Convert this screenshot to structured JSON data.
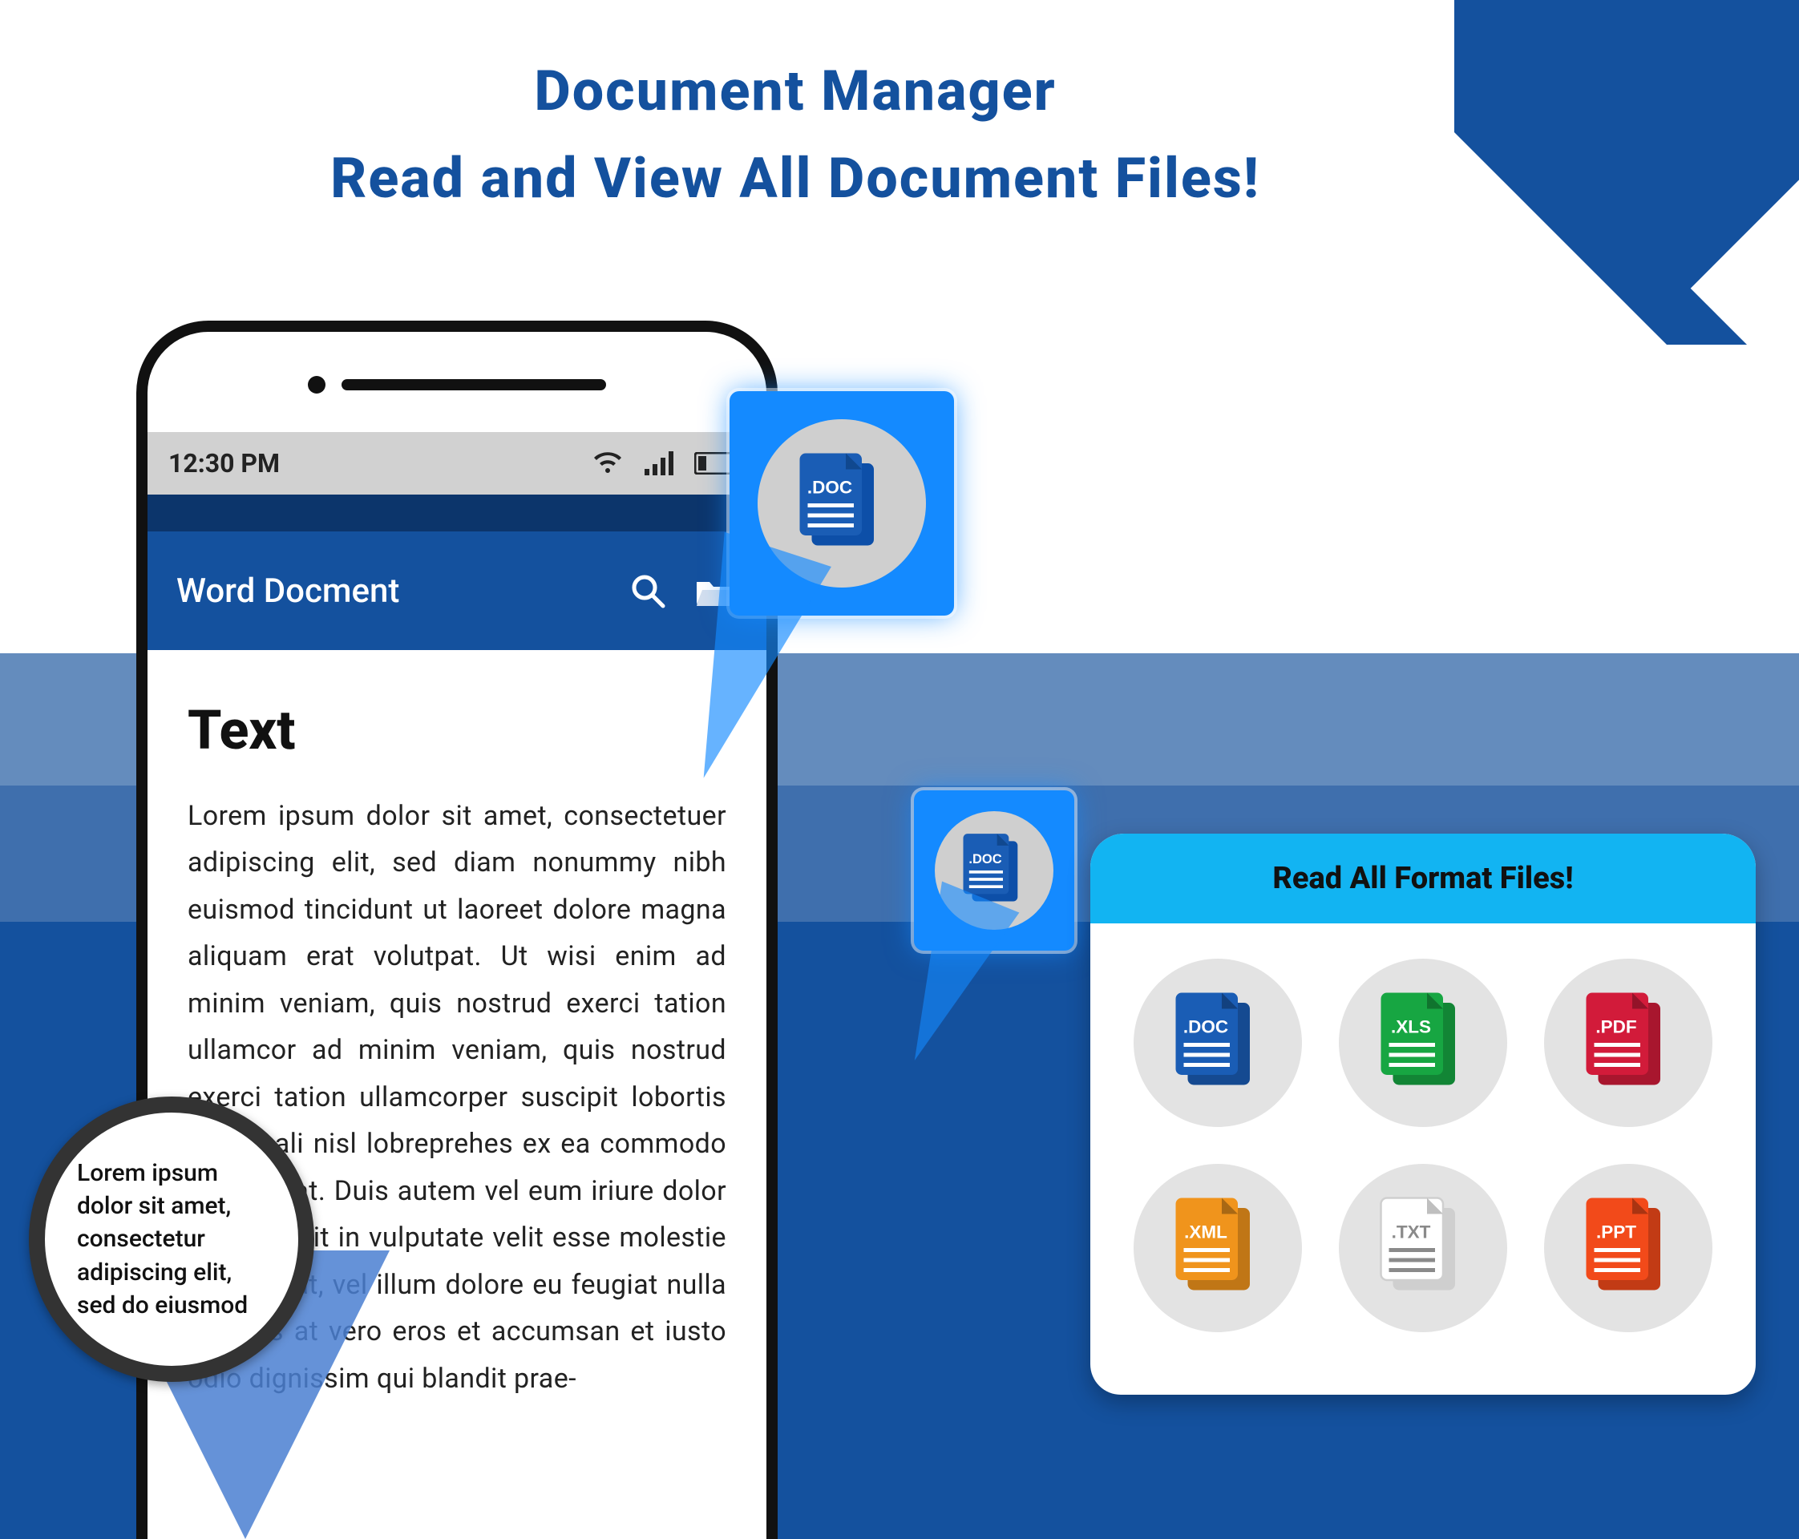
{
  "promo": {
    "line1": "Document Manager",
    "line2": "Read and View All Document Files!"
  },
  "phone": {
    "time": "12:30 PM",
    "appbar_title": "Word Docment",
    "content_heading": "Text",
    "body": "Lorem ipsum dolor sit amet, consectetuer adipiscing elit, sed diam nonummy nibh euismod tincidunt ut laoreet dolore magna aliquam erat volutpat. Ut wisi enim ad minim veniam, quis nostrud exerci tation ullamcor ad minim veniam, quis nostrud exerci tation ullamcorper suscipit lobortis nisl ut ali nisl lobreprehes ex ea commodo consequat. Duis autem vel eum iriure dolor in hendrerit in vulputate velit esse molestie consequat, vel illum dolore eu feugiat nulla facilisis at vero eros et accumsan et iusto odio dignissim qui blandit prae-"
  },
  "magnifier": {
    "text": "Lorem ipsum dolor sit amet, consectetur adipiscing elit, sed do eiusmod"
  },
  "formats_panel": {
    "title": "Read All Format Files!",
    "items": [
      {
        "label": ".DOC",
        "color": "#1a5db5"
      },
      {
        "label": ".XLS",
        "color": "#17a642"
      },
      {
        "label": ".PDF",
        "color": "#d21b3a"
      },
      {
        "label": ".XML",
        "color": "#f0941c"
      },
      {
        "label": ".TXT",
        "color": "#ffffff"
      },
      {
        "label": ".PPT",
        "color": "#f24a1a"
      }
    ]
  },
  "colors": {
    "brand": "#14519e",
    "accent": "#148aff",
    "panel_header": "#12b4f2"
  }
}
